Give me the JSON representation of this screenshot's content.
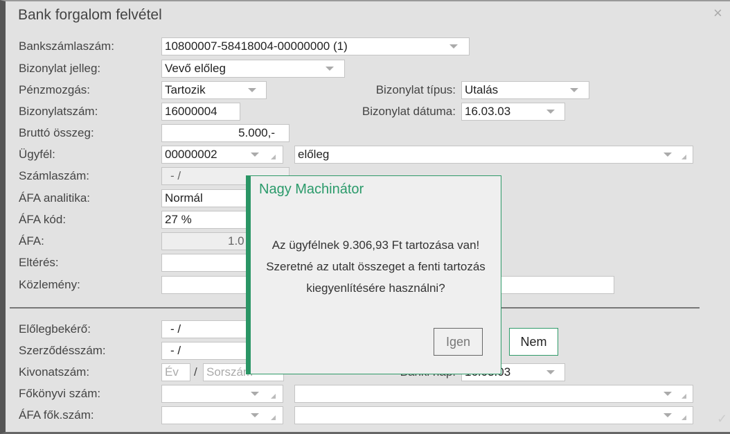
{
  "window": {
    "title": "Bank forgalom felvétel"
  },
  "labels": {
    "bankszamla": "Bankszámlaszám:",
    "jelleg": "Bizonylat jelleg:",
    "penzmozgas": "Pénzmozgás:",
    "bizonylatszam": "Bizonylatszám:",
    "brutto": "Bruttó összeg:",
    "ugyfel": "Ügyfél:",
    "szamlaszam": "Számlaszám:",
    "afa_analitika": "ÁFA analitika:",
    "afa_kod": "ÁFA kód:",
    "afa": "ÁFA:",
    "elteres": "Eltérés:",
    "kozlemeny": "Közlemény:",
    "tipus": "Bizonylat típus:",
    "datum": "Bizonylat dátuma:",
    "elolegbekero": "Előlegbekérő:",
    "szerzodes": "Szerződésszám:",
    "kivonat": "Kivonatszám:",
    "fokonyv": "Főkönyvi szám:",
    "afa_fok": "ÁFA fők.szám:",
    "banki_nap": "Banki nap:"
  },
  "values": {
    "bankszamla": "10800007-58418004-00000000 (1)",
    "jelleg": "Vevő előleg",
    "penzmozgas": "Tartozik",
    "bizonylatszam": "16000004",
    "brutto": "5.000,-",
    "ugyfel_kod": "00000002",
    "ugyfel_nev": "előleg",
    "szamlaszam": "- /",
    "afa_analitika": "Normál",
    "afa_kod": "27 %",
    "afa": "1.0",
    "tipus": "Utalás",
    "datum": "16.03.03",
    "elolegbekero": "- /",
    "szerzodes": "- /",
    "kivonat_ev_ph": "Év",
    "kivonat_sep": "/",
    "kivonat_sorszam_ph": "Sorszám",
    "banki_nap": "16.03.03"
  },
  "dialog": {
    "title": "Nagy Machinátor",
    "line1": "Az ügyfélnek 9.306,93 Ft tartozása van!",
    "line2": "Szeretné az utalt összeget a fenti tartozás",
    "line3": "kiegyenlítésére használni?",
    "yes": "Igen",
    "no": "Nem"
  },
  "icons": {
    "close": "×",
    "check": "✓"
  }
}
